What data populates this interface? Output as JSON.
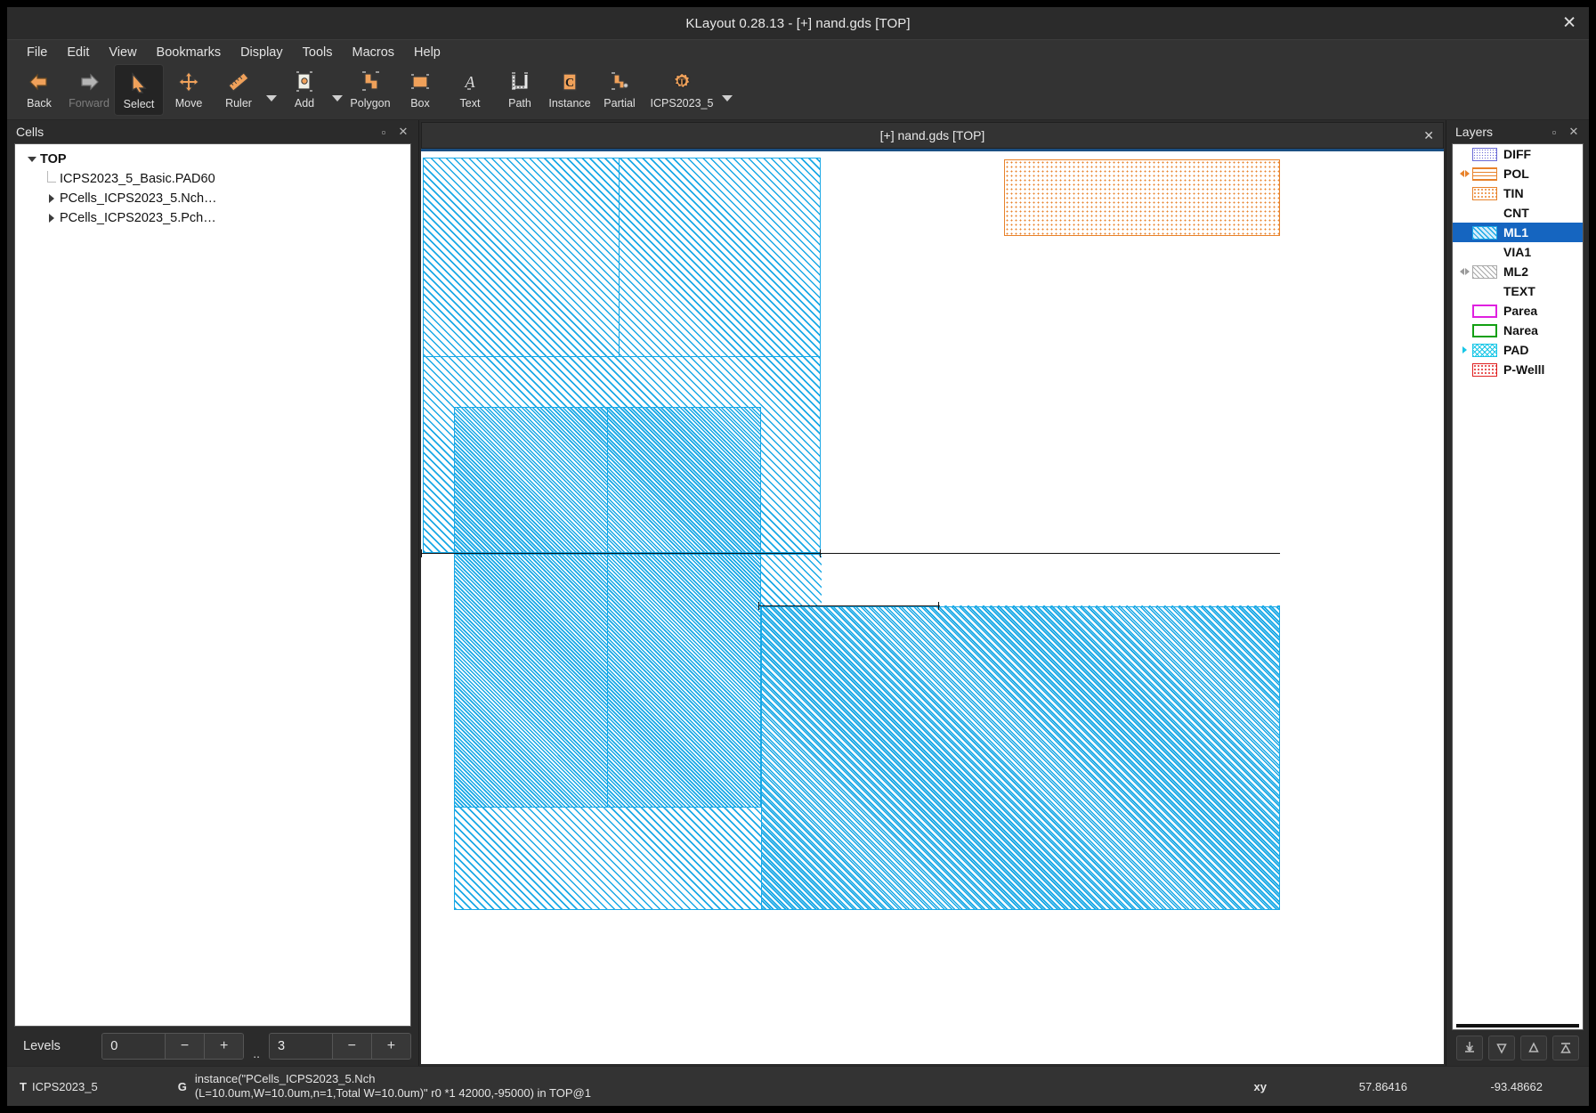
{
  "window": {
    "title": "KLayout 0.28.13 - [+] nand.gds [TOP]",
    "close_label": "✕"
  },
  "menubar": {
    "items": [
      {
        "label": "File"
      },
      {
        "label": "Edit"
      },
      {
        "label": "View"
      },
      {
        "label": "Bookmarks"
      },
      {
        "label": "Display"
      },
      {
        "label": "Tools"
      },
      {
        "label": "Macros"
      },
      {
        "label": "Help"
      }
    ]
  },
  "toolbar": {
    "items": [
      {
        "label": "Back",
        "icon": "arrow-left-icon",
        "state": "enabled"
      },
      {
        "label": "Forward",
        "icon": "arrow-right-icon",
        "state": "disabled"
      },
      {
        "label": "Select",
        "icon": "cursor-arrow-icon",
        "state": "active"
      },
      {
        "label": "Move",
        "icon": "move-cross-icon",
        "state": "enabled"
      },
      {
        "label": "Ruler",
        "icon": "ruler-icon",
        "state": "enabled"
      },
      {
        "label": "Add",
        "icon": "add-ruler-icon",
        "state": "enabled"
      },
      {
        "label": "Polygon",
        "icon": "polygon-icon",
        "state": "enabled"
      },
      {
        "label": "Box",
        "icon": "box-icon",
        "state": "enabled"
      },
      {
        "label": "Text",
        "icon": "text-a-icon",
        "state": "enabled"
      },
      {
        "label": "Path",
        "icon": "path-icon",
        "state": "enabled"
      },
      {
        "label": "Instance",
        "icon": "instance-c-icon",
        "state": "enabled"
      },
      {
        "label": "Partial",
        "icon": "partial-polygon-icon",
        "state": "enabled"
      },
      {
        "label": "ICPS2023_5",
        "icon": "technology-gear-icon",
        "state": "enabled"
      }
    ]
  },
  "cells": {
    "title": "Cells",
    "float_label": "▫",
    "close_label": "✕",
    "tree": [
      {
        "label": "TOP",
        "depth": 0,
        "marker": "expanded",
        "bold": true
      },
      {
        "label": "ICPS2023_5_Basic.PAD60",
        "depth": 1,
        "marker": "leaf",
        "bold": false
      },
      {
        "label": "PCells_ICPS2023_5.Nch…",
        "depth": 1,
        "marker": "collapsed",
        "bold": false
      },
      {
        "label": "PCells_ICPS2023_5.Pch…",
        "depth": 1,
        "marker": "collapsed",
        "bold": false
      }
    ],
    "levels": {
      "label": "Levels",
      "from_value": "0",
      "to_value": "3",
      "separator": "..",
      "minus_label": "−",
      "plus_label": "+"
    }
  },
  "view": {
    "tab_label": "[+] nand.gds [TOP]",
    "tab_close": "✕"
  },
  "layers": {
    "title": "Layers",
    "float_label": "▫",
    "close_label": "✕",
    "items": [
      {
        "name": "DIFF",
        "swatch": "sw-diff",
        "arrows": "none",
        "selected": false
      },
      {
        "name": "POL",
        "swatch": "sw-pol",
        "arrows": "orange",
        "selected": false
      },
      {
        "name": "TIN",
        "swatch": "sw-tin",
        "arrows": "none",
        "selected": false
      },
      {
        "name": "CNT",
        "swatch": "sw-none",
        "arrows": "none",
        "selected": false
      },
      {
        "name": "ML1",
        "swatch": "sw-ml1",
        "arrows": "none",
        "selected": true
      },
      {
        "name": "VIA1",
        "swatch": "sw-none",
        "arrows": "none",
        "selected": false
      },
      {
        "name": "ML2",
        "swatch": "sw-ml2",
        "arrows": "grey",
        "selected": false
      },
      {
        "name": "TEXT",
        "swatch": "sw-none",
        "arrows": "none",
        "selected": false
      },
      {
        "name": "Parea",
        "swatch": "sw-parea",
        "arrows": "none",
        "selected": false
      },
      {
        "name": "Narea",
        "swatch": "sw-narea",
        "arrows": "none",
        "selected": false
      },
      {
        "name": "PAD",
        "swatch": "sw-pad",
        "arrows": "cyan-right",
        "selected": false
      },
      {
        "name": "P-Welll",
        "swatch": "sw-pwell",
        "arrows": "none",
        "selected": false
      }
    ],
    "tools": [
      {
        "icon": "move-to-bottom-icon"
      },
      {
        "icon": "move-down-icon"
      },
      {
        "icon": "move-up-icon"
      },
      {
        "icon": "move-to-top-icon"
      }
    ]
  },
  "status": {
    "tech_badge": "T",
    "tech_name": "ICPS2023_5",
    "geom_badge": "G",
    "message": "instance(\"PCells_ICPS2023_5.Nch\n(L=10.0um,W=10.0um,n=1,Total W=10.0um)\" r0 *1 42000,-95000) in TOP@1",
    "xy_label": "xy",
    "x_value": "57.86416",
    "y_value": "-93.48662"
  },
  "colors": {
    "accent_orange": "#e8822a",
    "ml1_blue": "#19a8e6",
    "selection_blue": "#1565c0",
    "title_bar": "#2b2b2b",
    "panel_bg": "#333333",
    "canvas_bg": "#ffffff"
  }
}
